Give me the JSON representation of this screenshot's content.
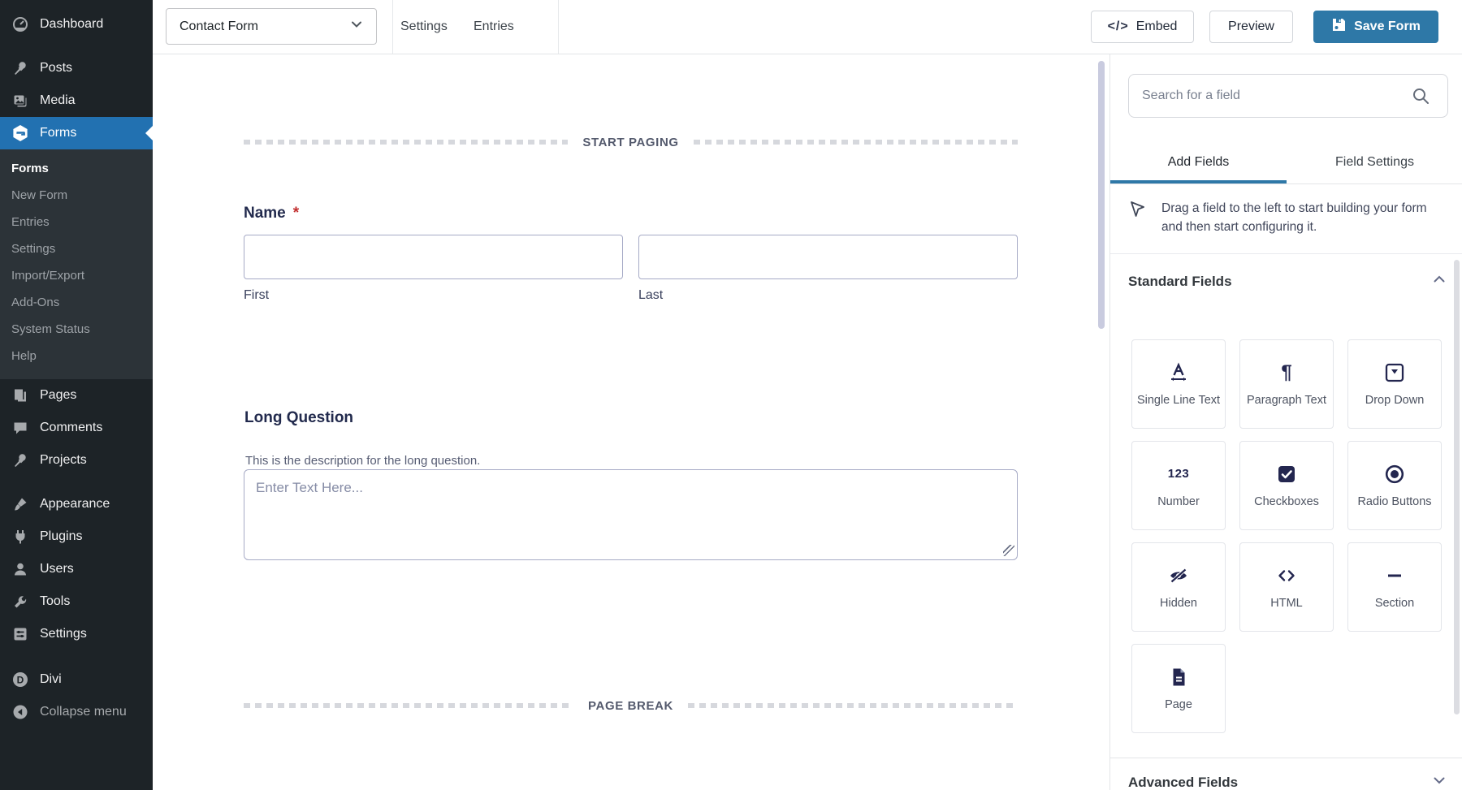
{
  "admin_menu": {
    "items": [
      {
        "label": "Dashboard"
      },
      {
        "label": "Posts"
      },
      {
        "label": "Media"
      },
      {
        "label": "Forms",
        "active": true
      },
      {
        "label": "Pages"
      },
      {
        "label": "Comments"
      },
      {
        "label": "Projects"
      },
      {
        "label": "Appearance"
      },
      {
        "label": "Plugins"
      },
      {
        "label": "Users"
      },
      {
        "label": "Tools"
      },
      {
        "label": "Settings"
      },
      {
        "label": "Divi"
      },
      {
        "label": "Collapse menu"
      }
    ],
    "forms_submenu": {
      "items": [
        {
          "label": "Forms",
          "active": true
        },
        {
          "label": "New Form"
        },
        {
          "label": "Entries"
        },
        {
          "label": "Settings"
        },
        {
          "label": "Import/Export"
        },
        {
          "label": "Add-Ons"
        },
        {
          "label": "System Status"
        },
        {
          "label": "Help"
        }
      ]
    }
  },
  "toolbar": {
    "form_selector_value": "Contact Form",
    "settings_tab": "Settings",
    "entries_tab": "Entries",
    "embed_icon": "</>",
    "embed_label": "Embed",
    "preview_label": "Preview",
    "save_label": "Save Form"
  },
  "canvas": {
    "start_paging_label": "START PAGING",
    "page_break_label": "PAGE BREAK",
    "name_field": {
      "label": "Name",
      "required_indicator": "*",
      "first_sublabel": "First",
      "last_sublabel": "Last",
      "first_value": "",
      "last_value": ""
    },
    "long_question_field": {
      "label": "Long Question",
      "description": "This is the description for the long question.",
      "placeholder": "Enter Text Here...",
      "value": ""
    }
  },
  "sidebar": {
    "search": {
      "placeholder": "Search for a field",
      "value": ""
    },
    "tabs": {
      "add_fields": "Add Fields",
      "field_settings": "Field Settings"
    },
    "hint": "Drag a field to the left to start building your form and then start configuring it.",
    "standard_fields": {
      "title": "Standard Fields",
      "fields": [
        {
          "label": "Single Line Text"
        },
        {
          "label": "Paragraph Text"
        },
        {
          "label": "Drop Down"
        },
        {
          "label": "Number"
        },
        {
          "label": "Checkboxes"
        },
        {
          "label": "Radio Buttons"
        },
        {
          "label": "Hidden"
        },
        {
          "label": "HTML"
        },
        {
          "label": "Section"
        },
        {
          "label": "Page"
        }
      ]
    },
    "advanced_fields": {
      "title": "Advanced Fields"
    }
  },
  "colors": {
    "menu_background": "#1d2327",
    "submenu_background": "#2c3338",
    "active_menu_blue": "#2271b1",
    "save_button_blue": "#2e78a7",
    "tab_accent_blue": "#2e78a7",
    "field_icon_navy": "#23264f",
    "required_red": "#c22f2f"
  }
}
